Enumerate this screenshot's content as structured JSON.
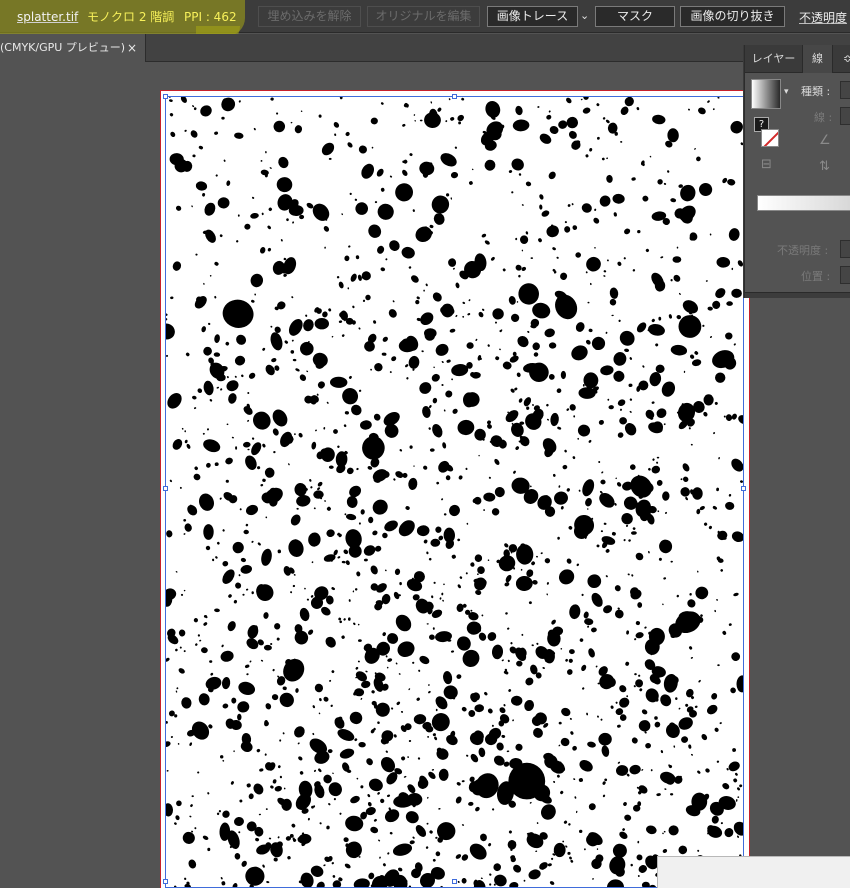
{
  "control_bar": {
    "filename": "splatter.tif",
    "color_mode": "モノクロ 2 階調",
    "ppi": "PPI : 462",
    "embed_button": "埋め込みを解除",
    "edit_original_button": "オリジナルを編集",
    "image_trace_button": "画像トレース",
    "mask_button": "マスク",
    "crop_button": "画像の切り抜き",
    "opacity_label": "不透明度"
  },
  "tabs": [
    {
      "label": "(CMYK/GPU プレビュー)",
      "close": "×"
    }
  ],
  "panel": {
    "tabs": [
      "レイヤー",
      "線"
    ],
    "type_label": "種類 :",
    "stroke_label": "線 :",
    "question": "?",
    "opacity_label": "不透明度 :",
    "position_label": "位置 :"
  },
  "icons": {
    "dropdown": "chevron-down-icon",
    "panel_menu": "panel-menu-icon",
    "angle": "angle-icon",
    "aspect": "aspect-icon",
    "align": "align-icon"
  },
  "colors": {
    "highlight": "#a8a814",
    "highlight_text": "#f7f05a",
    "artboard_border": "#c8202a",
    "selection": "#3f6cdb"
  }
}
